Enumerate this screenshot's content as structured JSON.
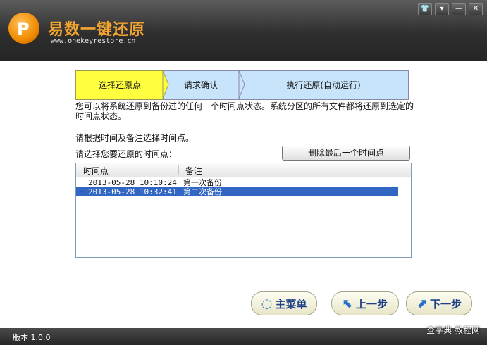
{
  "app": {
    "title": "易数一键还原",
    "url": "www.onekeyrestore.cn",
    "logo_letter": "P"
  },
  "window_buttons": {
    "skin": "👕",
    "menu": "▾",
    "minimize": "—",
    "close": "✕"
  },
  "steps": [
    "选择还原点",
    "请求确认",
    "执行还原(自动运行)"
  ],
  "description": "您可以将系统还原到备份过的任何一个时间点状态。系统分区的所有文件都将还原到选定的时间点状态。",
  "hint1": "请根据时间及备注选择时间点。",
  "hint2": "请选择您要还原的时间点：",
  "delete_button": "删除最后一个时间点",
  "list": {
    "columns": [
      "时间点",
      "备注"
    ],
    "rows": [
      {
        "time": "2013-05-28 10:10:24",
        "note": "第一次备份",
        "selected": false
      },
      {
        "time": "2013-05-28 10:32:41",
        "note": "第二次备份",
        "selected": true
      }
    ]
  },
  "buttons": {
    "main_menu": "主菜单",
    "prev": "上一步",
    "next": "下一步"
  },
  "version": "版本 1.0.0",
  "watermark": "查字典 教程网"
}
